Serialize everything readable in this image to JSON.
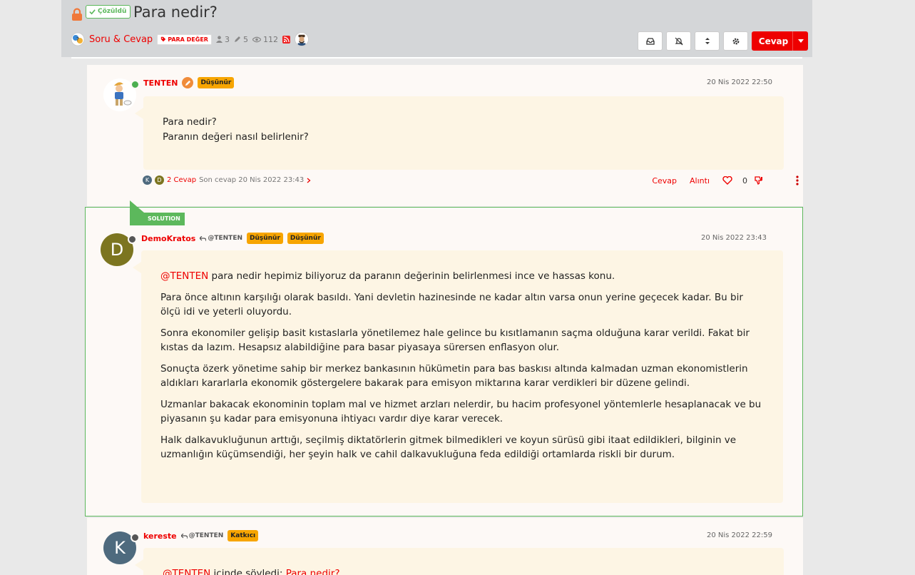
{
  "topic": {
    "solved_label": "Çözüldü",
    "title": "Para nedir?",
    "category": "Soru & Cevap",
    "tag": "PARA DEĞER",
    "posters": "3",
    "posts": "5",
    "views": "112"
  },
  "toolbar": {
    "reply_label": "Cevap"
  },
  "posts": [
    {
      "username": "TENTEN",
      "badges": [
        "Düşünür"
      ],
      "timestamp": "20 Nis 2022 22:50",
      "status_color": "#4caf50",
      "paragraphs": [
        "Para nedir?",
        "Paranın değeri nasıl belirlenir?"
      ],
      "replies_count": "2 Cevap",
      "last_reply": "Son cevap 20 Nis 2022 23:43",
      "reply_avatars": [
        "K",
        "D"
      ],
      "actions": {
        "reply": "Cevap",
        "quote": "Alıntı",
        "votes": "0"
      }
    },
    {
      "solution_label": "SOLUTION",
      "username": "DemoKratos",
      "reply_to": "@TENTEN",
      "badges": [
        "Düşünür",
        "Düşünür"
      ],
      "timestamp": "20 Nis 2022 23:43",
      "avatar_letter": "D",
      "avatar_color": "#7c7520",
      "status_color": "#555555",
      "mention": "@TENTEN",
      "first_para_rest": " para nedir hepimiz biliyoruz da paranın değerinin belirlenmesi ince ve hassas konu.",
      "paragraphs": [
        "Para önce altının karşılığı olarak basıldı. Yani devletin hazinesinde ne kadar altın varsa onun yerine geçecek kadar. Bu bir ölçü idi ve yeterli oluyordu.",
        "Sonra ekonomiler gelişip basit kıstaslarla yönetilemez hale gelince bu kısıtlamanın saçma olduğuna karar verildi. Fakat bir kıstas da lazım. Hesapsız alabildiğine para basar piyasaya sürersen enflasyon olur.",
        "Sonuçta özerk yönetime sahip bir merkez bankasının hükümetin para bas baskısı altında kalmadan uzman ekonomistlerin aldıkları kararlarla ekonomik göstergelere bakarak para emisyon miktarına karar verdikleri bir düzene gelindi.",
        "Uzmanlar bakacak ekonominin toplam mal ve hizmet arzları nelerdir, bu hacim profesyonel yöntemlerle hesaplanacak ve bu piyasanın şu kadar para emisyonuna ihtiyacı vardır diye karar verecek.",
        "Halk dalkavukluğunun arttığı, seçilmiş diktatörlerin gitmek bilmedikleri ve koyun sürüsü gibi itaat edildikleri, bilginin ve uzmanlığın küçümsendiği, her şeyin halk ve cahil dalkavukluğuna feda edildiği ortamlarda riskli bir durum."
      ]
    },
    {
      "username": "kereste",
      "reply_to": "@TENTEN",
      "badges": [
        "Katkıcı"
      ],
      "timestamp": "20 Nis 2022 22:59",
      "avatar_letter": "K",
      "avatar_color": "#4e6a7e",
      "status_color": "#555555",
      "mention": "@TENTEN",
      "first_para_rest": " içinde söyledi: ",
      "link": "Para nedir?"
    }
  ],
  "colors": {
    "accent": "#e00000",
    "solved": "#5cb85c",
    "badge": "#f7a500"
  }
}
